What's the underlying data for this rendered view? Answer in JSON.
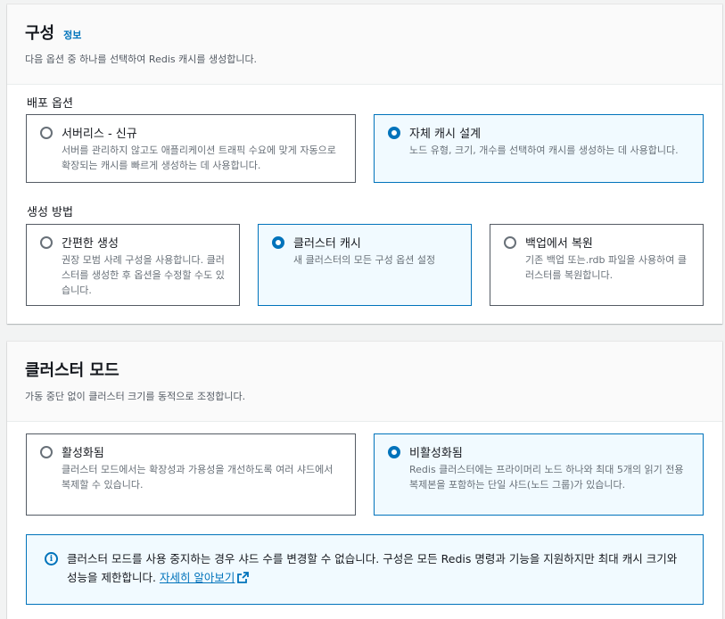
{
  "config_panel": {
    "title": "구성",
    "info": "정보",
    "description": "다음 옵션 중 하나를 선택하여 Redis 캐시를 생성합니다.",
    "deployment": {
      "label": "배포 옵션",
      "options": [
        {
          "title": "서버리스 - 신규",
          "description": "서버를 관리하지 않고도 애플리케이션 트래픽 수요에 맞게 자동으로 확장되는 캐시를 빠르게 생성하는 데 사용합니다.",
          "selected": false
        },
        {
          "title": "자체 캐시 설계",
          "description": "노드 유형, 크기, 개수를 선택하여 캐시를 생성하는 데 사용합니다.",
          "selected": true
        }
      ]
    },
    "creation": {
      "label": "생성 방법",
      "options": [
        {
          "title": "간편한 생성",
          "description": "권장 모범 사례 구성을 사용합니다. 클러스터를 생성한 후 옵션을 수정할 수도 있습니다.",
          "selected": false
        },
        {
          "title": "클러스터 캐시",
          "description": "새 클러스터의 모든 구성 옵션 설정",
          "selected": true
        },
        {
          "title": "백업에서 복원",
          "description": "기존 백업 또는.rdb 파일을 사용하여 클러스터를 복원합니다.",
          "selected": false
        }
      ]
    }
  },
  "cluster_mode_panel": {
    "title": "클러스터 모드",
    "description": "가동 중단 없이 클러스터 크기를 동적으로 조정합니다.",
    "options": [
      {
        "title": "활성화됨",
        "description": "클러스터 모드에서는 확장성과 가용성을 개선하도록 여러 샤드에서 복제할 수 있습니다.",
        "selected": false
      },
      {
        "title": "비활성화됨",
        "description": "Redis 클러스터에는 프라이머리 노드 하나와 최대 5개의 읽기 전용 복제본을 포함하는 단일 샤드(노드 그룹)가 있습니다.",
        "selected": true
      }
    ],
    "alert": {
      "text": "클러스터 모드를 사용 중지하는 경우 샤드 수를 변경할 수 없습니다. 구성은 모든 Redis 명령과 기능을 지원하지만 최대 캐시 크기와 성능을 제한합니다.",
      "link": "자세히 알아보기"
    }
  },
  "colors": {
    "accent": "#0073bb",
    "selected_bg": "#f1faff",
    "page_bg": "#f2f3f3"
  }
}
